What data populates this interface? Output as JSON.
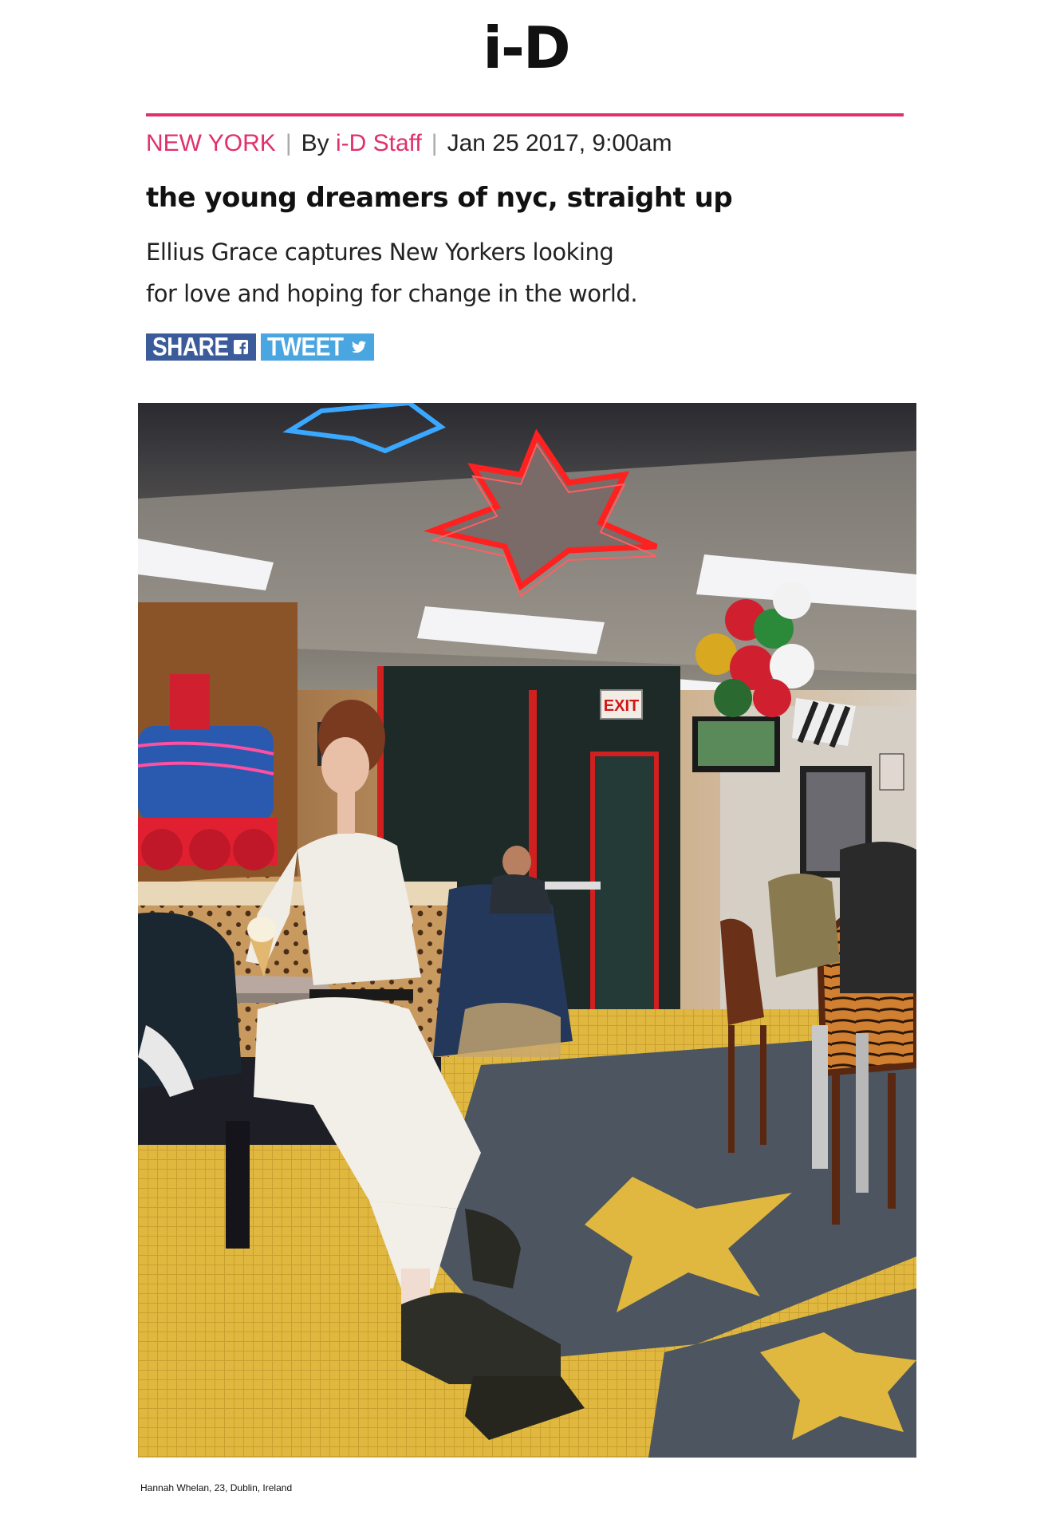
{
  "site": {
    "logo": "i-D",
    "accent_color": "#e0306e"
  },
  "article": {
    "section": "NEW YORK",
    "by_label": "By",
    "author": "i-D Staff",
    "date": "Jan 25 2017, 9:00am",
    "title": "the young dreamers of nyc, straight up",
    "dek_line1": "Ellius Grace captures New Yorkers looking",
    "dek_line2": "for love and hoping for change in the world."
  },
  "share": {
    "facebook_label": "SHARE",
    "facebook_icon": "facebook-icon",
    "facebook_color": "#3b5b9a",
    "twitter_label": "TWEET",
    "twitter_icon": "twitter-icon",
    "twitter_color": "#4aa6e0"
  },
  "photo": {
    "exit_sign": "EXIT",
    "caption": "Hannah Whelan, 23, Dublin, Ireland"
  }
}
